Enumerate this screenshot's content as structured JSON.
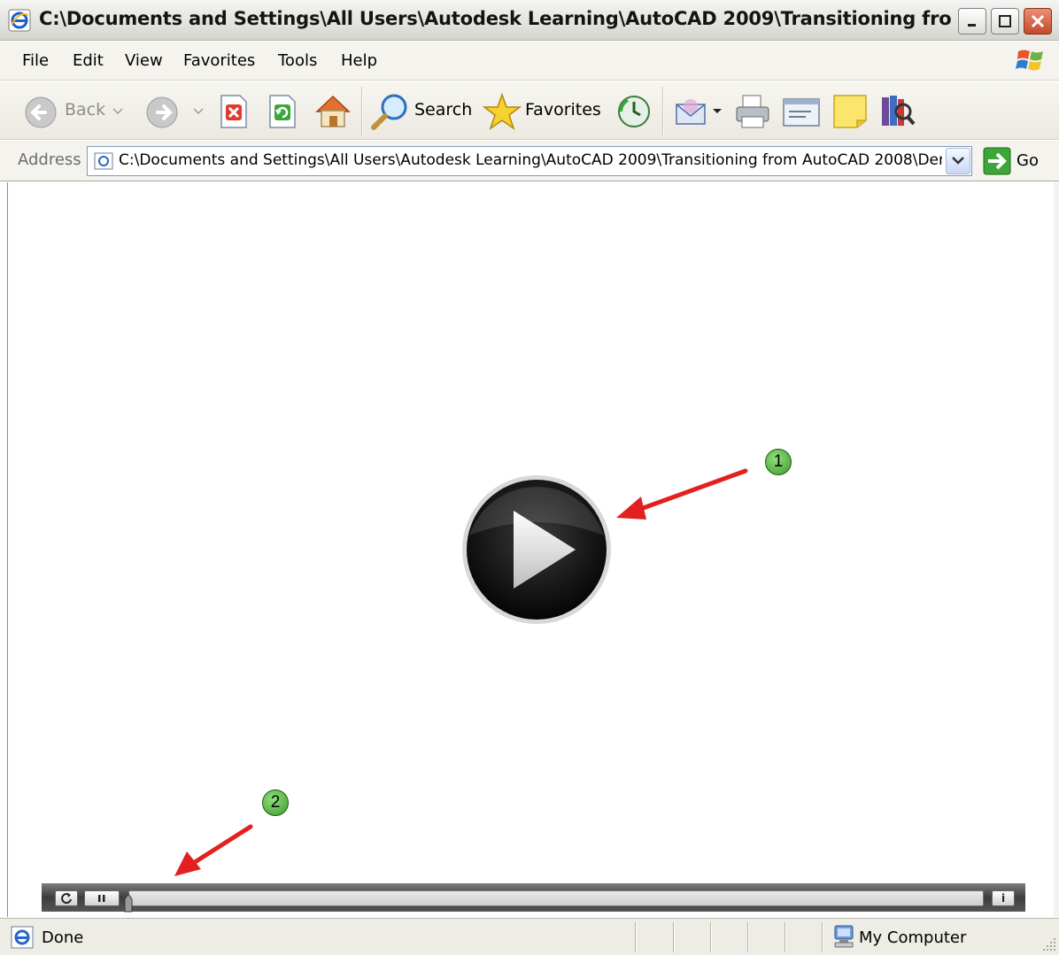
{
  "window": {
    "title": "C:\\Documents and Settings\\All Users\\Autodesk Learning\\AutoCAD 2009\\Transitioning from A..."
  },
  "menu": {
    "items": [
      "File",
      "Edit",
      "View",
      "Favorites",
      "Tools",
      "Help"
    ]
  },
  "toolbar": {
    "back_label": "Back",
    "search_label": "Search",
    "favorites_label": "Favorites"
  },
  "address": {
    "label": "Address",
    "value": "C:\\Documents and Settings\\All Users\\Autodesk Learning\\AutoCAD 2009\\Transitioning from AutoCAD 2008\\Dem",
    "go_label": "Go"
  },
  "player": {
    "replay_icon": "replay-icon",
    "pause_icon": "pause-icon",
    "info_label": "i",
    "progress": 0.0
  },
  "callouts": [
    "1",
    "2"
  ],
  "colors": {
    "arrow": "#e32020",
    "callout_fill": "#5cb946",
    "player_bar": "#4a4a4a"
  },
  "status": {
    "text": "Done",
    "zone": "My Computer"
  }
}
